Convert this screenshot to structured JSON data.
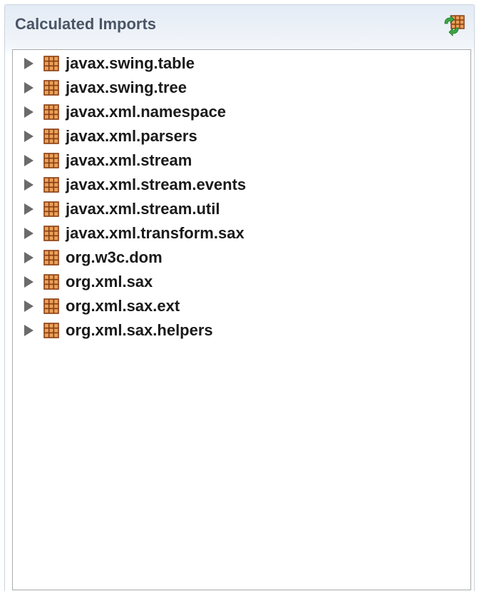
{
  "panel": {
    "title": "Calculated Imports",
    "header_button_icon": "refresh-imports-icon"
  },
  "tree": {
    "items": [
      {
        "label": "javax.swing.table",
        "icon": "package-icon",
        "expanded": false
      },
      {
        "label": "javax.swing.tree",
        "icon": "package-icon",
        "expanded": false
      },
      {
        "label": "javax.xml.namespace",
        "icon": "package-icon",
        "expanded": false
      },
      {
        "label": "javax.xml.parsers",
        "icon": "package-icon",
        "expanded": false
      },
      {
        "label": "javax.xml.stream",
        "icon": "package-icon",
        "expanded": false
      },
      {
        "label": "javax.xml.stream.events",
        "icon": "package-icon",
        "expanded": false
      },
      {
        "label": "javax.xml.stream.util",
        "icon": "package-icon",
        "expanded": false
      },
      {
        "label": "javax.xml.transform.sax",
        "icon": "package-icon",
        "expanded": false
      },
      {
        "label": "org.w3c.dom",
        "icon": "package-icon",
        "expanded": false
      },
      {
        "label": "org.xml.sax",
        "icon": "package-icon",
        "expanded": false
      },
      {
        "label": "org.xml.sax.ext",
        "icon": "package-icon",
        "expanded": false
      },
      {
        "label": "org.xml.sax.helpers",
        "icon": "package-icon",
        "expanded": false
      }
    ]
  },
  "colors": {
    "package_icon_fill": "#e9a05a",
    "package_icon_stroke": "#8a3e12",
    "expander": "#6b6b6b",
    "title_text": "#4a5566"
  }
}
